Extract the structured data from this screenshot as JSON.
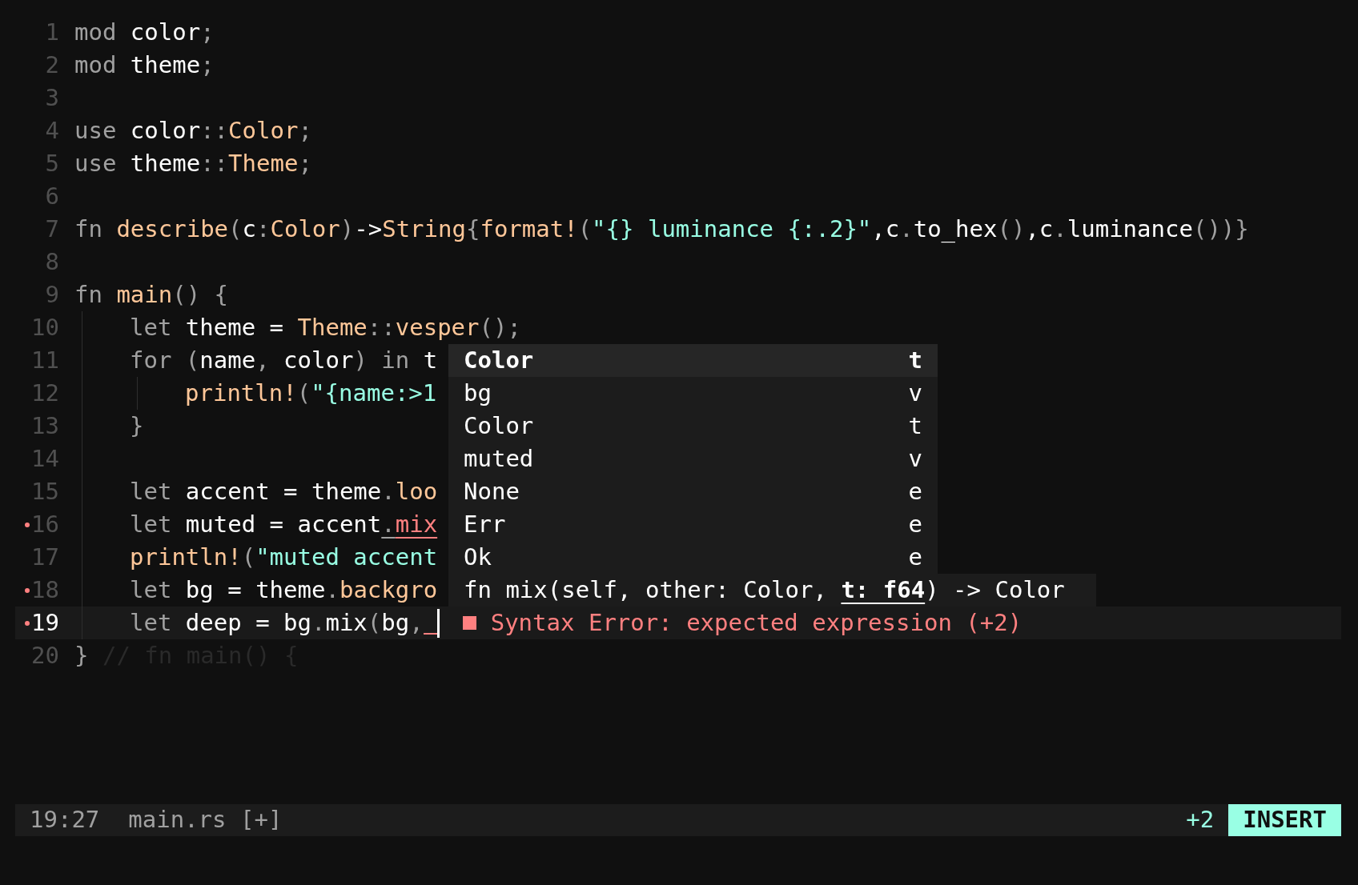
{
  "editor": {
    "lines": [
      {
        "number": "1",
        "current": false,
        "diagnostic": false,
        "tokens": [
          {
            "t": "mod ",
            "kind": "keyword"
          },
          {
            "t": "color",
            "kind": "identifier"
          },
          {
            "t": ";",
            "kind": "punctuation"
          }
        ]
      },
      {
        "number": "2",
        "current": false,
        "diagnostic": false,
        "tokens": [
          {
            "t": "mod ",
            "kind": "keyword"
          },
          {
            "t": "theme",
            "kind": "identifier"
          },
          {
            "t": ";",
            "kind": "punctuation"
          }
        ]
      },
      {
        "number": "3",
        "current": false,
        "diagnostic": false
      },
      {
        "number": "4",
        "current": false,
        "diagnostic": false,
        "tokens": [
          {
            "t": "use ",
            "kind": "keyword"
          },
          {
            "t": "color",
            "kind": "identifier"
          },
          {
            "t": "::",
            "kind": "punctuation"
          },
          {
            "t": "Color",
            "kind": "function"
          },
          {
            "t": ";",
            "kind": "punctuation"
          }
        ]
      },
      {
        "number": "5",
        "current": false,
        "diagnostic": false,
        "tokens": [
          {
            "t": "use ",
            "kind": "keyword"
          },
          {
            "t": "theme",
            "kind": "identifier"
          },
          {
            "t": "::",
            "kind": "punctuation"
          },
          {
            "t": "Theme",
            "kind": "function"
          },
          {
            "t": ";",
            "kind": "punctuation"
          }
        ]
      },
      {
        "number": "6",
        "current": false,
        "diagnostic": false
      },
      {
        "number": "7",
        "current": false,
        "diagnostic": false,
        "tokens": [
          {
            "t": "fn ",
            "kind": "keyword"
          },
          {
            "t": "describe",
            "kind": "function"
          },
          {
            "t": "(",
            "kind": "punctuation"
          },
          {
            "t": "c",
            "kind": "identifier"
          },
          {
            "t": ":",
            "kind": "punctuation"
          },
          {
            "t": "Color",
            "kind": "function"
          },
          {
            "t": ")",
            "kind": "punctuation"
          },
          {
            "t": "->",
            "kind": "identifier"
          },
          {
            "t": "String",
            "kind": "function"
          },
          {
            "t": "{",
            "kind": "punctuation"
          },
          {
            "t": "format!",
            "kind": "function"
          },
          {
            "t": "(",
            "kind": "punctuation"
          },
          {
            "t": "\"{} luminance {:.2}\"",
            "kind": "string"
          },
          {
            "t": ",c",
            "kind": "identifier"
          },
          {
            "t": ".",
            "kind": "punctuation"
          },
          {
            "t": "to_hex",
            "kind": "identifier"
          },
          {
            "t": "()",
            "kind": "punctuation"
          },
          {
            "t": ",c",
            "kind": "identifier"
          },
          {
            "t": ".",
            "kind": "punctuation"
          },
          {
            "t": "luminance",
            "kind": "identifier"
          },
          {
            "t": "())}",
            "kind": "punctuation"
          }
        ]
      },
      {
        "number": "8",
        "current": false,
        "diagnostic": false
      },
      {
        "number": "9",
        "current": false,
        "diagnostic": false,
        "tokens": [
          {
            "t": "fn ",
            "kind": "keyword"
          },
          {
            "t": "main",
            "kind": "function"
          },
          {
            "t": "() {",
            "kind": "punctuation"
          }
        ],
        "children": [
          {
            "number": "10",
            "current": false,
            "diagnostic": false,
            "tokens": [
              {
                "t": "let ",
                "kind": "keyword"
              },
              {
                "t": "theme = ",
                "kind": "identifier"
              },
              {
                "t": "Theme",
                "kind": "function"
              },
              {
                "t": "::",
                "kind": "punctuation"
              },
              {
                "t": "vesper",
                "kind": "function"
              },
              {
                "t": "();",
                "kind": "punctuation"
              }
            ]
          },
          {
            "number": "11",
            "current": false,
            "diagnostic": false,
            "tokens": [
              {
                "t": "for (",
                "kind": "keyword"
              },
              {
                "t": "name",
                "kind": "identifier"
              },
              {
                "t": ", ",
                "kind": "punctuation"
              },
              {
                "t": "color",
                "kind": "identifier"
              },
              {
                "t": ") in ",
                "kind": "keyword"
              },
              {
                "t": "t",
                "kind": "identifier"
              }
            ],
            "children": [
              {
                "number": "12",
                "current": false,
                "diagnostic": false,
                "tokens": [
                  {
                    "t": "println!",
                    "kind": "function"
                  },
                  {
                    "t": "(",
                    "kind": "punctuation"
                  },
                  {
                    "t": "\"{name:>1",
                    "kind": "string"
                  }
                ]
              }
            ]
          },
          {
            "number": "13",
            "current": false,
            "diagnostic": false,
            "tokens": [
              {
                "t": "}",
                "kind": "punctuation"
              }
            ]
          },
          {
            "number": "14",
            "current": false,
            "diagnostic": false
          },
          {
            "number": "15",
            "current": false,
            "diagnostic": false,
            "tokens": [
              {
                "t": "let ",
                "kind": "keyword"
              },
              {
                "t": "accent = theme",
                "kind": "identifier"
              },
              {
                "t": ".",
                "kind": "punctuation"
              },
              {
                "t": "loo",
                "kind": "function"
              }
            ]
          },
          {
            "number": "16",
            "current": false,
            "diagnostic": true,
            "tokens": [
              {
                "t": "let ",
                "kind": "keyword"
              },
              {
                "t": "muted = accent",
                "kind": "identifier"
              },
              {
                "t": ".",
                "kind": "underlined"
              },
              {
                "t": "mix",
                "kind": "error"
              }
            ]
          },
          {
            "number": "17",
            "current": false,
            "diagnostic": false,
            "tokens": [
              {
                "t": "println!",
                "kind": "function"
              },
              {
                "t": "(",
                "kind": "punctuation"
              },
              {
                "t": "\"muted accent",
                "kind": "string"
              }
            ]
          },
          {
            "number": "18",
            "current": false,
            "diagnostic": true,
            "tokens": [
              {
                "t": "let ",
                "kind": "keyword"
              },
              {
                "t": "bg = theme",
                "kind": "identifier"
              },
              {
                "t": ".",
                "kind": "punctuation"
              },
              {
                "t": "backgro",
                "kind": "function"
              }
            ]
          },
          {
            "number": "19",
            "current": true,
            "diagnostic": true,
            "tokens": [
              {
                "t": "let ",
                "kind": "keyword"
              },
              {
                "t": "deep = bg",
                "kind": "identifier"
              },
              {
                "t": ".",
                "kind": "punctuation"
              },
              {
                "t": "mix",
                "kind": "identifier"
              },
              {
                "t": "(",
                "kind": "punctuation"
              },
              {
                "t": "bg",
                "kind": "identifier"
              },
              {
                "t": ",",
                "kind": "punctuation"
              }
            ],
            "diagnostic_message": "Syntax Error: expected expression (+2)"
          }
        ]
      },
      {
        "number": "20",
        "current": false,
        "diagnostic": false,
        "tokens": [
          {
            "t": "}",
            "kind": "punctuation"
          },
          {
            "t": " // fn main() {",
            "kind": "comment"
          }
        ]
      }
    ],
    "completion": {
      "items": [
        {
          "label": "Color",
          "kind": "t",
          "selected": true
        },
        {
          "label": "bg",
          "kind": "v",
          "selected": false
        },
        {
          "label": "Color",
          "kind": "t",
          "selected": false
        },
        {
          "label": "muted",
          "kind": "v",
          "selected": false
        },
        {
          "label": "None",
          "kind": "e",
          "selected": false
        },
        {
          "label": "Err",
          "kind": "e",
          "selected": false
        },
        {
          "label": "Ok",
          "kind": "e",
          "selected": false
        }
      ],
      "signature": "fn mix(self, other: Color, **t: f64**) -> Color"
    }
  },
  "status_bar": {
    "position": "19:27",
    "file": "main.rs [+]",
    "diagnostics": "+2",
    "mode": "INSERT"
  }
}
